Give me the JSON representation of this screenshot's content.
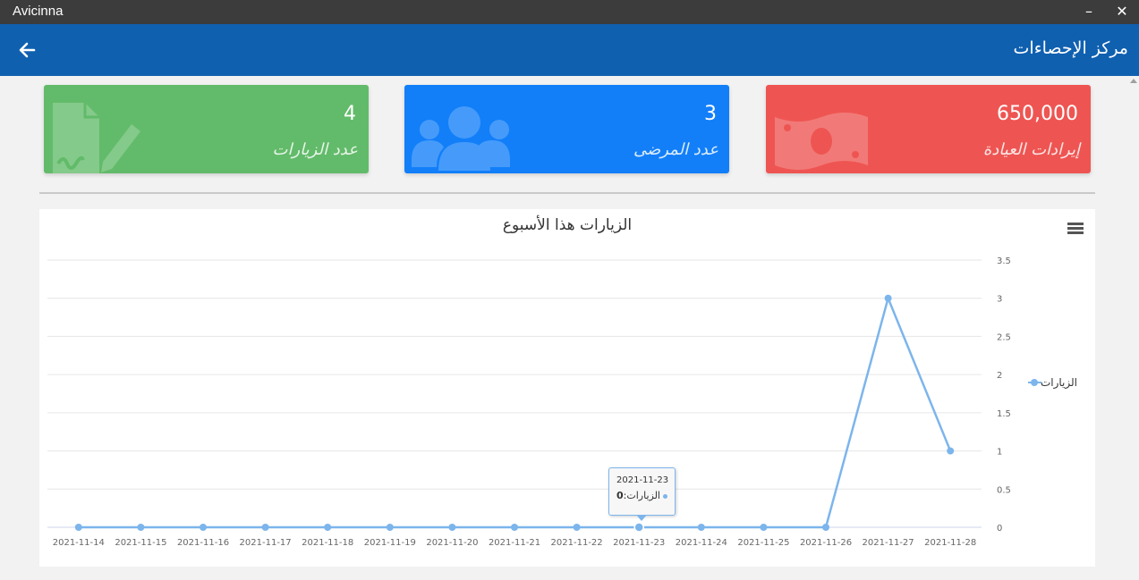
{
  "window": {
    "app_title": "Avicinna",
    "minimize_glyph": "–",
    "close_glyph": "✕"
  },
  "header": {
    "title": "مركز الإحصاءات",
    "back_icon": "arrow-left-icon",
    "color": "#1060b0"
  },
  "cards": [
    {
      "value": "4",
      "label": "عدد الزيارات",
      "icon": "signature-document-icon",
      "color": "#62bb6a"
    },
    {
      "value": "3",
      "label": "عدد المرضى",
      "icon": "users-group-icon",
      "color": "#127ff9"
    },
    {
      "value": "650,000",
      "label": "إيرادات العيادة",
      "icon": "money-bill-icon",
      "color": "#ee5552"
    }
  ],
  "chart": {
    "menu_icon": "hamburger-menu-icon",
    "tooltip": {
      "date": "2021-11-23",
      "series": "الزيارات",
      "value": "0"
    }
  },
  "chart_data": {
    "type": "line",
    "title": "الزيارات هذا الأسبوع",
    "x": [
      "2021-11-14",
      "2021-11-15",
      "2021-11-16",
      "2021-11-17",
      "2021-11-18",
      "2021-11-19",
      "2021-11-20",
      "2021-11-21",
      "2021-11-22",
      "2021-11-23",
      "2021-11-24",
      "2021-11-25",
      "2021-11-26",
      "2021-11-27",
      "2021-11-28"
    ],
    "series": [
      {
        "name": "الزيارات",
        "values": [
          0,
          0,
          0,
          0,
          0,
          0,
          0,
          0,
          0,
          0,
          0,
          0,
          0,
          3,
          1
        ],
        "color": "#7cb5ec"
      }
    ],
    "ylim": [
      0,
      3.5
    ],
    "yticks": [
      "0",
      "0.5",
      "1",
      "1.5",
      "2",
      "2.5",
      "3",
      "3.5"
    ],
    "y_axis_side": "right",
    "grid": true,
    "legend_placement": "right"
  }
}
